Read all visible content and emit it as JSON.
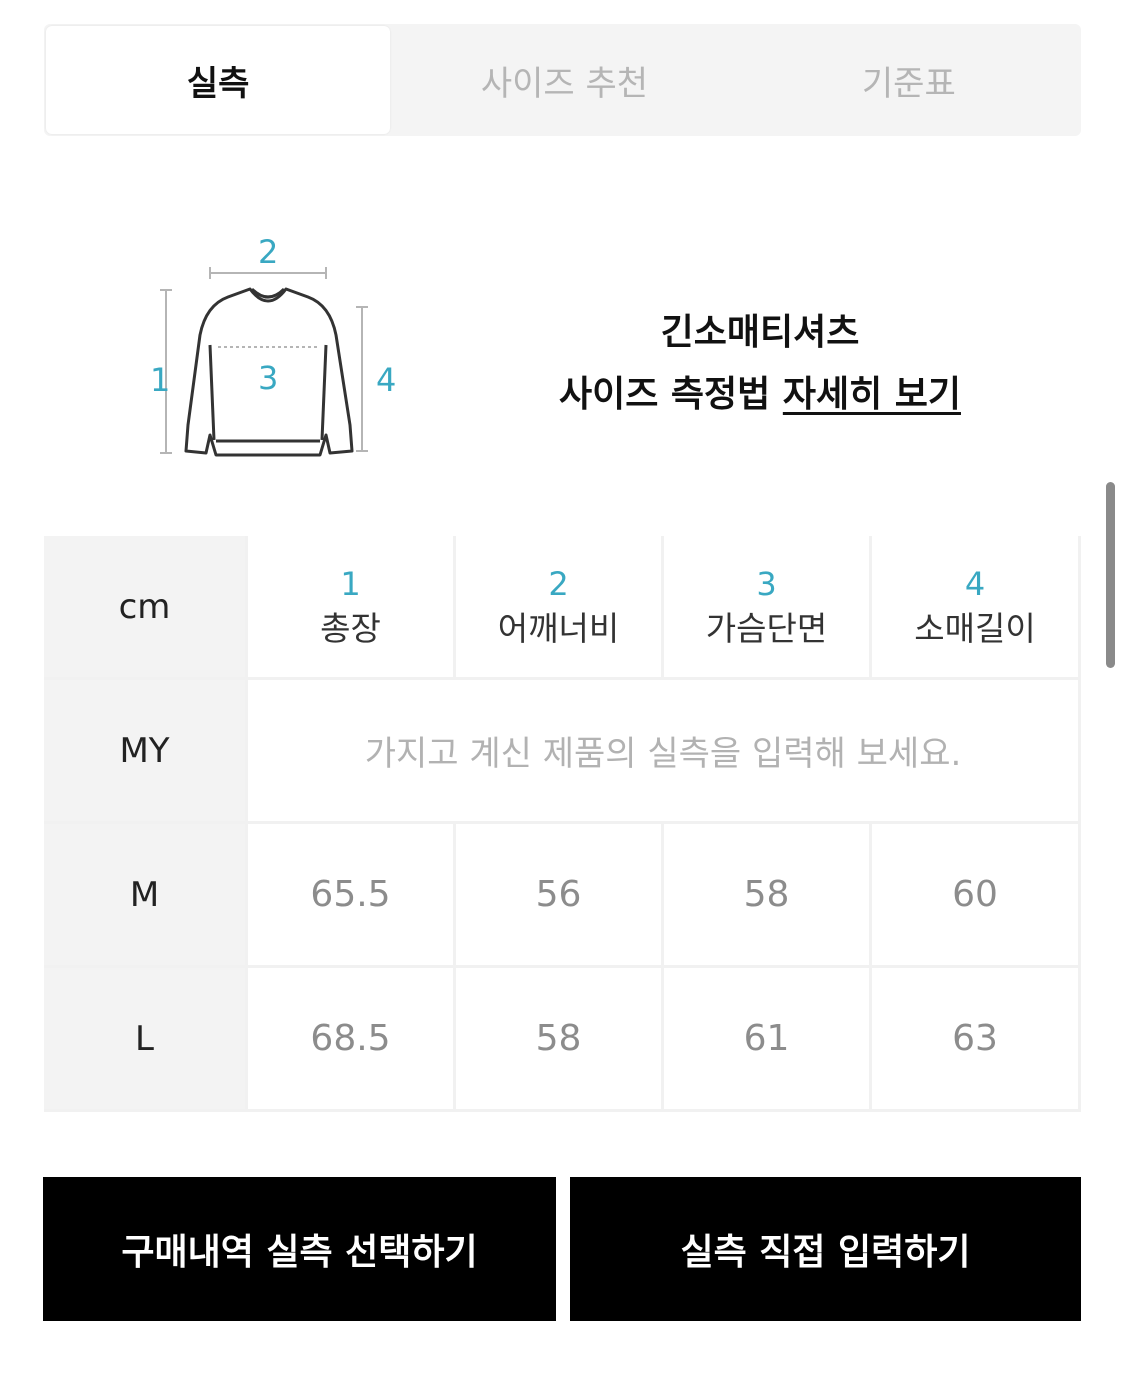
{
  "tabs": [
    {
      "label": "실측",
      "active": true
    },
    {
      "label": "사이즈 추천",
      "active": false
    },
    {
      "label": "기준표",
      "active": false
    }
  ],
  "illustration": {
    "markers": [
      "1",
      "2",
      "3",
      "4"
    ],
    "marker_color": "#39a8c2"
  },
  "product": {
    "name": "긴소매티셔츠",
    "guide_prefix": "사이즈 측정법",
    "guide_link": "자세히 보기"
  },
  "table": {
    "unit": "cm",
    "columns": [
      {
        "num": "1",
        "name": "총장"
      },
      {
        "num": "2",
        "name": "어깨너비"
      },
      {
        "num": "3",
        "name": "가슴단면"
      },
      {
        "num": "4",
        "name": "소매길이"
      }
    ],
    "my_row": {
      "label": "MY",
      "placeholder": "가지고 계신 제품의 실측을 입력해 보세요."
    },
    "rows": [
      {
        "size": "M",
        "values": [
          "65.5",
          "56",
          "58",
          "60"
        ]
      },
      {
        "size": "L",
        "values": [
          "68.5",
          "58",
          "61",
          "63"
        ]
      }
    ]
  },
  "buttons": {
    "select_history": "구매내역 실측 선택하기",
    "direct_input": "실측 직접 입력하기"
  }
}
